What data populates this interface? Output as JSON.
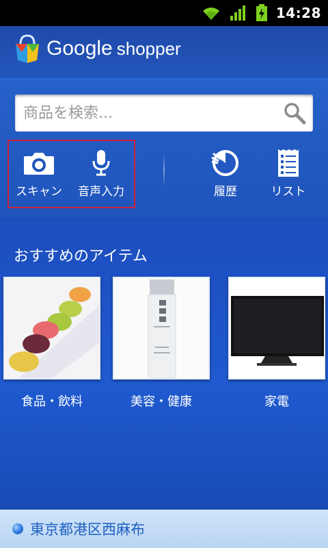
{
  "status_bar": {
    "time": "14:28"
  },
  "app": {
    "name_primary": "Google",
    "name_secondary": "shopper"
  },
  "search": {
    "placeholder": "商品を検索...",
    "value": ""
  },
  "tools": [
    {
      "label": "スキャン",
      "icon": "camera-icon"
    },
    {
      "label": "音声入力",
      "icon": "microphone-icon"
    },
    {
      "label": "履歴",
      "icon": "history-icon"
    },
    {
      "label": "リスト",
      "icon": "list-icon"
    }
  ],
  "recommended": {
    "title": "おすすめのアイテム",
    "categories": [
      {
        "label": "食品・飲料",
        "image": "macarons"
      },
      {
        "label": "美容・健康",
        "image": "cosmetic-bottle"
      },
      {
        "label": "家電",
        "image": "television"
      }
    ]
  },
  "location": {
    "text": "東京都港区西麻布"
  },
  "colors": {
    "accent": "#1f54bb",
    "highlight": "#d0213a",
    "location_bar": "#cfe3f9"
  }
}
